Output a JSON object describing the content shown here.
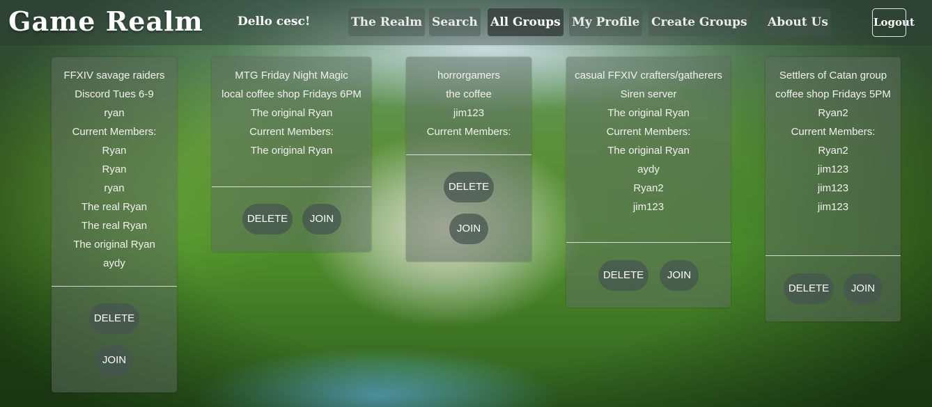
{
  "header": {
    "logo": "Game Realm",
    "greeting": "Dello cesc!",
    "nav": [
      "The Realm",
      "Search",
      "All Groups",
      "My Profile",
      "Create Groups",
      "About Us"
    ],
    "active_nav": "All Groups",
    "logout_label": "Logout"
  },
  "buttons": {
    "delete": "DELETE",
    "join": "JOIN"
  },
  "groups": [
    {
      "lines": [
        "FFXIV savage raiders",
        "Discord Tues 6-9",
        "ryan",
        "Current Members:",
        "Ryan",
        "Ryan",
        "ryan",
        "The real Ryan",
        "The real Ryan",
        "The original Ryan",
        "aydy"
      ]
    },
    {
      "lines": [
        "MTG Friday Night Magic",
        "local coffee shop Fridays 6PM",
        "The original Ryan",
        "Current Members:",
        "The original Ryan"
      ]
    },
    {
      "lines": [
        "horrorgamers",
        "the coffee",
        "jim123",
        "Current Members:"
      ]
    },
    {
      "lines": [
        "casual FFXIV crafters/gatherers",
        "Siren server",
        "The original Ryan",
        "Current Members:",
        "The original Ryan",
        "aydy",
        "Ryan2",
        "jim123"
      ]
    },
    {
      "lines": [
        "Settlers of Catan group",
        "coffee shop Fridays 5PM",
        "Ryan2",
        "Current Members:",
        "Ryan2",
        "jim123",
        "jim123",
        "jim123"
      ]
    }
  ]
}
